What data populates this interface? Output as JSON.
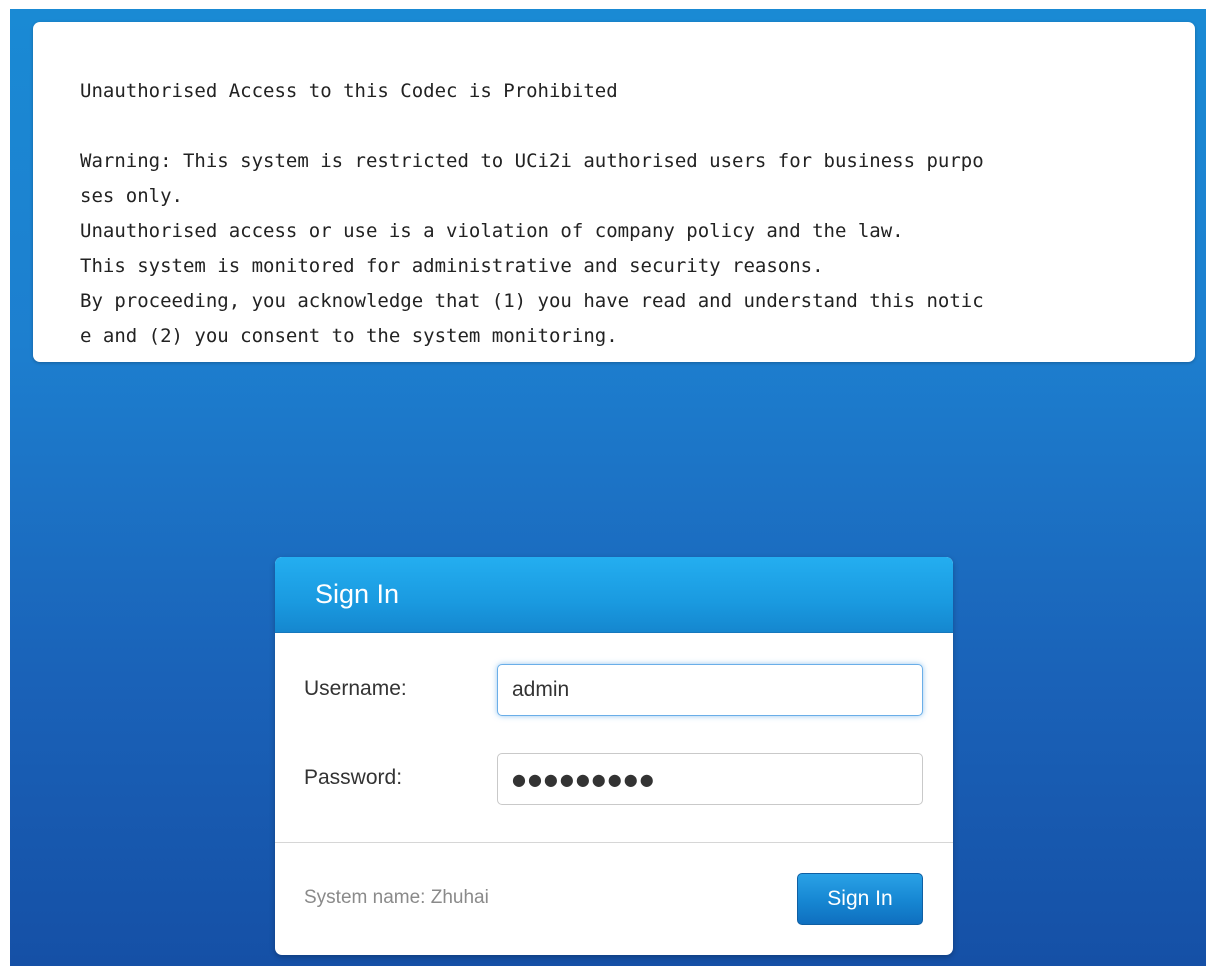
{
  "banner": {
    "text": "Unauthorised Access to this Codec is Prohibited\n\nWarning: This system is restricted to UCi2i authorised users for business purpo\nses only.\nUnauthorised access or use is a violation of company policy and the law.\nThis system is monitored for administrative and security reasons.\nBy proceeding, you acknowledge that (1) you have read and understand this notic\ne and (2) you consent to the system monitoring."
  },
  "signin": {
    "title": "Sign In",
    "username_label": "Username:",
    "username_value": "admin",
    "password_label": "Password:",
    "password_value": "●●●●●●●●●",
    "system_name": "System name: Zhuhai",
    "button_label": "Sign In"
  },
  "colors": {
    "background_top": "#1a8ad4",
    "background_bottom": "#1550a6",
    "header_blue": "#1a9ae0",
    "button_blue": "#1686d2"
  }
}
